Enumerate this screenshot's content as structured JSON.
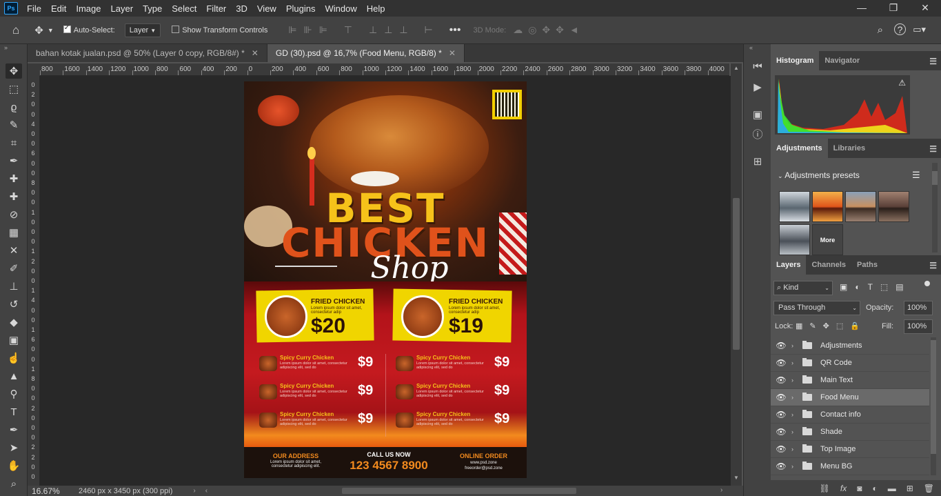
{
  "app": {
    "logo_text": "Ps",
    "menu": [
      "File",
      "Edit",
      "Image",
      "Layer",
      "Type",
      "Select",
      "Filter",
      "3D",
      "View",
      "Plugins",
      "Window",
      "Help"
    ]
  },
  "options": {
    "auto_select_label": "Auto-Select:",
    "auto_select_target": "Layer",
    "show_transform_label": "Show Transform Controls",
    "mode_3d_label": "3D Mode:"
  },
  "tabs": [
    {
      "label": "bahan kotak jualan.psd @ 50% (Layer 0 copy, RGB/8#) *"
    },
    {
      "label": "GD (30).psd @ 16,7% (Food Menu, RGB/8) *"
    }
  ],
  "ruler": {
    "h_labels": [
      "800",
      "1600",
      "1400",
      "1200",
      "1000",
      "800",
      "600",
      "400",
      "200",
      "0",
      "200",
      "400",
      "600",
      "800",
      "1000",
      "1200",
      "1400",
      "1600",
      "1800",
      "2000",
      "2200",
      "2400",
      "2600",
      "2800",
      "3000",
      "3200",
      "3400",
      "3600",
      "3800",
      "4000"
    ],
    "v_labels": [
      "0",
      "2",
      "0",
      "0",
      "4",
      "0",
      "0",
      "6",
      "0",
      "0",
      "8",
      "0",
      "0",
      "1",
      "0",
      "0",
      "0",
      "1",
      "2",
      "0",
      "0",
      "1",
      "4",
      "0",
      "0",
      "1",
      "6",
      "0",
      "0",
      "1",
      "8",
      "0",
      "0",
      "2",
      "0",
      "0",
      "0",
      "2",
      "2",
      "0",
      "0"
    ]
  },
  "status": {
    "zoom": "16.67%",
    "doc_info": "2460 px x 3450 px (300 ppi)"
  },
  "flyer": {
    "title1": "BEST",
    "title2": "CHICKEN",
    "title3": "Shop",
    "featured": [
      {
        "name": "FRIED CHICKEN",
        "desc": "Lorem ipsum dolor sit amet, consectetur adip",
        "price": "$20"
      },
      {
        "name": "FRIED CHICKEN",
        "desc": "Lorem ipsum dolor sit amet, consectetur adip",
        "price": "$19"
      }
    ],
    "menu_items": [
      {
        "name": "Spicy Curry Chicken",
        "desc": "Lorem ipsum dolor sit amet, consectetur adipiscing elit, sed do",
        "price": "$9"
      },
      {
        "name": "Spicy Curry Chicken",
        "desc": "Lorem ipsum dolor sit amet, consectetur adipiscing elit, sed do",
        "price": "$9"
      },
      {
        "name": "Spicy Curry Chicken",
        "desc": "Lorem ipsum dolor sit amet, consectetur adipiscing elit, sed do",
        "price": "$9"
      },
      {
        "name": "Spicy Curry Chicken",
        "desc": "Lorem ipsum dolor sit amet, consectetur adipiscing elit, sed do",
        "price": "$9"
      },
      {
        "name": "Spicy Curry Chicken",
        "desc": "Lorem ipsum dolor sit amet, consectetur adipiscing elit, sed do",
        "price": "$9"
      },
      {
        "name": "Spicy Curry Chicken",
        "desc": "Lorem ipsum dolor sit amet, consectetur adipiscing elit, sed do",
        "price": "$9"
      }
    ],
    "address_title": "OUR ADDRESS",
    "address_text": "Lorem ipsum dolor sit amet, consectetur adipiscing elit.",
    "call_title": "CALL US NOW",
    "call_number": "123 4567 8900",
    "order_title": "ONLINE ORDER",
    "order_site": "www.psd.zone",
    "order_email": "freeorder@psd.zone"
  },
  "panels": {
    "top_tabs": [
      "Histogram",
      "Navigator"
    ],
    "adj_tabs": [
      "Adjustments",
      "Libraries"
    ],
    "adj_presets_title": "Adjustments presets",
    "more_label": "More",
    "layer_tabs": [
      "Layers",
      "Channels",
      "Paths"
    ],
    "kind_label": "Kind",
    "blend_mode": "Pass Through",
    "opacity_label": "Opacity:",
    "opacity_value": "100%",
    "lock_label": "Lock:",
    "fill_label": "Fill:",
    "fill_value": "100%",
    "layers": [
      "Adjustments",
      "QR Code",
      "Main Text",
      "Food Menu",
      "Contact info",
      "Shade",
      "Top Image",
      "Menu BG"
    ]
  }
}
